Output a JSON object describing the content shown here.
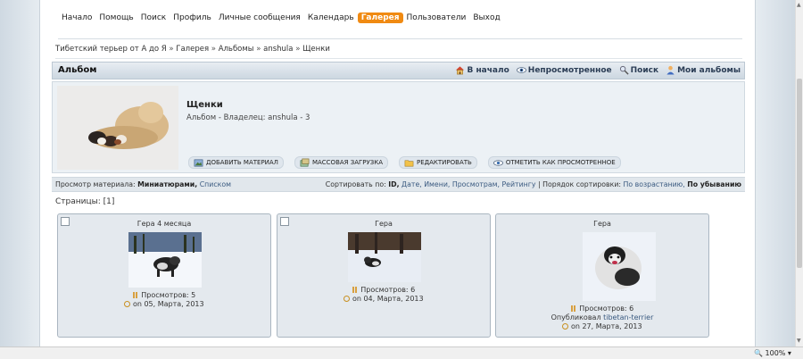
{
  "nav": {
    "items": [
      "Начало",
      "Помощь",
      "Поиск",
      "Профиль",
      "Личные сообщения",
      "Календарь",
      "Галерея",
      "Пользователи",
      "Выход"
    ],
    "active": "Галерея"
  },
  "breadcrumb": {
    "items": [
      "Тибетский терьер от А до Я",
      "Галерея",
      "Альбомы",
      "anshula",
      "Щенки"
    ],
    "separator": "»"
  },
  "header": {
    "title": "Альбом",
    "links": {
      "home": "В начало",
      "unread": "Непросмотренное",
      "search": "Поиск",
      "myalbums": "Мои альбомы"
    }
  },
  "album": {
    "name": "Щенки",
    "subtitle": "Альбом - Владелец: anshula - 3",
    "buttons": {
      "add": "ДОБАВИТЬ МАТЕРИАЛ",
      "bulk": "МАССОВАЯ ЗАГРУЗКА",
      "edit": "РЕДАКТИРОВАТЬ",
      "mark": "ОТМЕТИТЬ КАК ПРОСМОТРЕННОЕ"
    }
  },
  "options": {
    "view_label": "Просмотр материала:",
    "view_current": "Миниатюрами,",
    "view_other": "Списком",
    "sort_label": "Сортировать по:",
    "sort_current": "ID,",
    "sort_others": "Дате, Имени, Просмотрам, Рейтингу",
    "order_sep": "|",
    "order_label": "Порядок сортировки:",
    "order_other": "По возрастанию,",
    "order_current": "По убыванию"
  },
  "pagination": {
    "label": "Страницы:",
    "current": "[1]"
  },
  "items": [
    {
      "title": "Гера 4 месяца",
      "views": "Просмотров: 5",
      "date": "on 05, Марта, 2013"
    },
    {
      "title": "Гера",
      "views": "Просмотров: 6",
      "date": "on 04, Марта, 2013"
    },
    {
      "title": "Гера",
      "views": "Просмотров: 6",
      "posted_label": "Опубликовал",
      "posted_by": "tibetan-terrier",
      "date": "on 27, Марта, 2013"
    }
  ],
  "status": {
    "zoom": "100%"
  },
  "colors": {
    "accent": "#f08a12",
    "header_bg": "#ccd7e1",
    "link": "#3a5a80"
  }
}
